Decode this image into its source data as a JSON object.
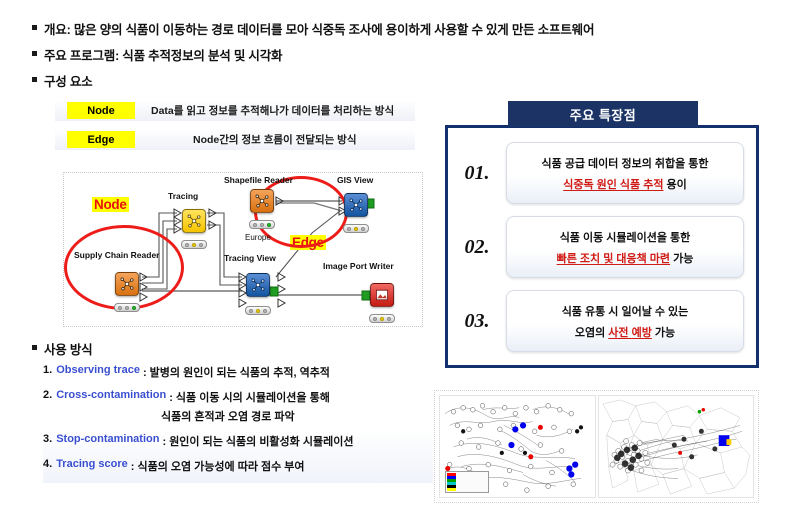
{
  "overview": {
    "bullets": [
      "개요: 많은 양의 식품이 이동하는 경로 데이터를 모아 식중독 조사에 용이하게 사용할 수 있게 만든 소프트웨어",
      "주요 프로그램: 식품 추적정보의 분석 및 시각화",
      "구성 요소"
    ],
    "usage_heading": "사용 방식"
  },
  "legend": {
    "rows": [
      {
        "key": "Node",
        "desc": "Data를 읽고 정보를 추적해나가 데이터를 처리하는 방식"
      },
      {
        "key": "Edge",
        "desc": "Node간의 정보 흐름이 전달되는 방식"
      }
    ]
  },
  "diagram": {
    "callouts": {
      "node": "Node",
      "edge": "Edge"
    },
    "nodes": [
      {
        "label": "Supply Chain Reader",
        "sublabel": "",
        "color": "orange",
        "status": "green"
      },
      {
        "label": "Tracing",
        "sublabel": "",
        "color": "yellow",
        "status": "amber"
      },
      {
        "label": "Shapefile Reader",
        "sublabel": "Europe",
        "color": "orange",
        "status": "green"
      },
      {
        "label": "GIS View",
        "sublabel": "",
        "color": "blue",
        "status": "amber"
      },
      {
        "label": "Tracing View",
        "sublabel": "",
        "color": "blue",
        "status": "amber"
      },
      {
        "label": "Image Port Writer",
        "sublabel": "",
        "color": "red",
        "status": "amber"
      }
    ]
  },
  "usage": {
    "items": [
      {
        "num": "1.",
        "en": "Observing trace",
        "ko": ": 발병의 원인이 되는 식품의 추적, 역추적",
        "cont": ""
      },
      {
        "num": "2.",
        "en": "Cross-contamination",
        "ko": ": 식품 이동 시의 시뮬레이션을 통해",
        "cont": "식품의 흔적과 오염 경로 파악"
      },
      {
        "num": "3.",
        "en": "Stop-contamination",
        "ko": ": 원인이 되는 식품의 비활성화 시뮬레이션",
        "cont": ""
      },
      {
        "num": "4.",
        "en": "Tracing score",
        "ko": ": 식품의 오염 가능성에 따라 점수 부여",
        "cont": ""
      }
    ]
  },
  "features": {
    "title": "주요 특장점",
    "items": [
      {
        "num": "01.",
        "line1": "식품 공급 데이터 정보의 취합을 통한",
        "line2_em": "식중독 원인 식품 추적",
        "line2_tail": " 용이"
      },
      {
        "num": "02.",
        "line1": "식품 이동 시뮬레이션을 통한",
        "line2_em": "빠른 조치 및 대응책 마련",
        "line2_tail": " 가능"
      },
      {
        "num": "03.",
        "line1": "식품 유통 시 일어날 수 있는",
        "line2_lead": "오염의 ",
        "line2_em": "사전 예방",
        "line2_tail": " 가능"
      }
    ]
  },
  "colors": {
    "panel_border": "#12306b",
    "title_bg": "#1b3365",
    "emphasis_red": "#d01a14",
    "link_blue": "#3a4fd0",
    "highlight_yellow": "#ffff00",
    "callout_red": "#ee1c18"
  },
  "network": {
    "legend_swatches": [
      "#ff0000",
      "#0000ff",
      "#00a000",
      "#00c8c8",
      "#000000",
      "#ffff00"
    ]
  }
}
